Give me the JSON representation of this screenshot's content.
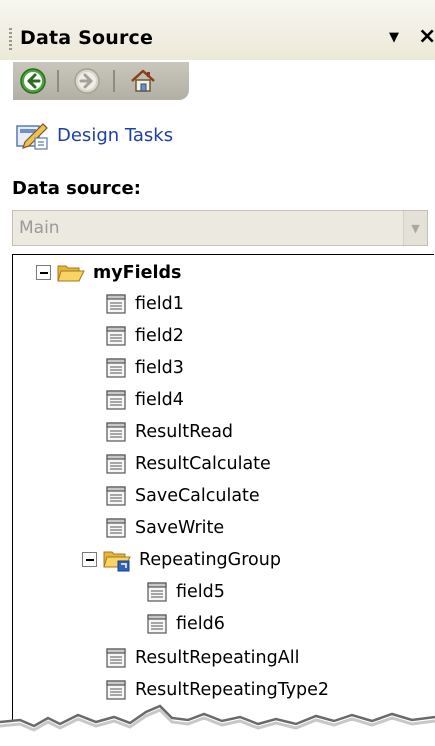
{
  "header": {
    "title": "Data Source",
    "menu_glyph": "▼",
    "close_glyph": "×"
  },
  "nav": {
    "back_icon": "back-arrow-icon",
    "forward_icon": "forward-arrow-icon",
    "home_icon": "home-icon"
  },
  "tasks": {
    "design_tasks_label": "Design Tasks",
    "icon": "design-tasks-icon"
  },
  "data_source": {
    "label": "Data source:",
    "selected": "Main"
  },
  "tree": {
    "root": {
      "label": "myFields"
    },
    "fields_top": [
      "field1",
      "field2",
      "field3",
      "field4",
      "ResultRead",
      "ResultCalculate",
      "SaveCalculate",
      "SaveWrite"
    ],
    "group": {
      "label": "RepeatingGroup",
      "children": [
        "field5",
        "field6"
      ]
    },
    "fields_bottom": [
      "ResultRepeatingAll",
      "ResultRepeatingType2"
    ]
  },
  "colors": {
    "link": "#1c3fa8",
    "folder": "#f3c03c",
    "panel_bg": "#ece9d8"
  }
}
